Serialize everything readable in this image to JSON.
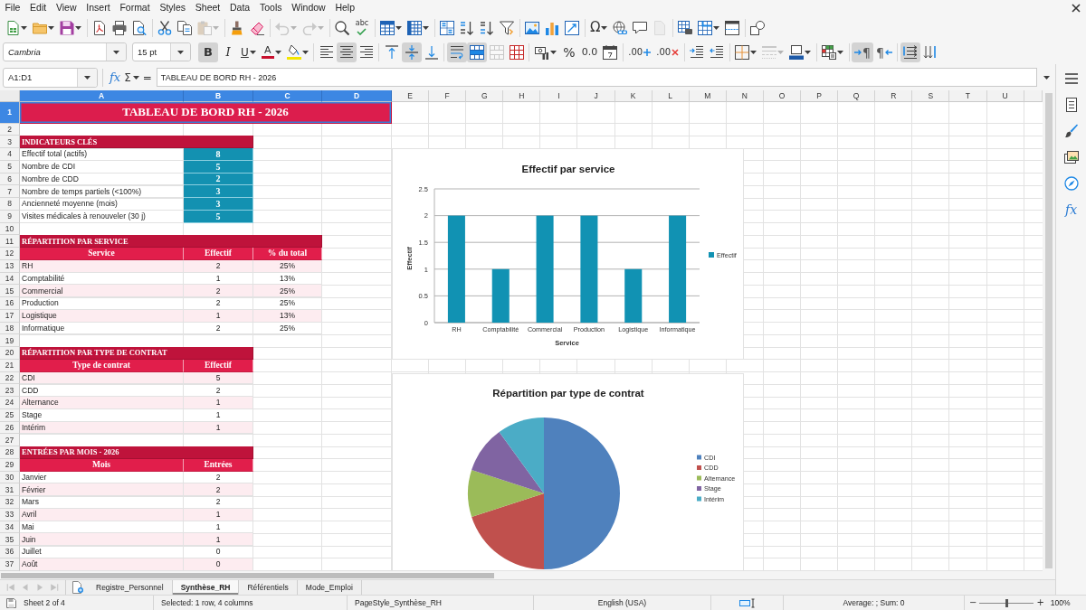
{
  "menu_bar": {
    "items": [
      "File",
      "Edit",
      "View",
      "Insert",
      "Format",
      "Styles",
      "Sheet",
      "Data",
      "Tools",
      "Window",
      "Help"
    ]
  },
  "standard_toolbar": [
    {
      "kind": "new",
      "dropdown": true,
      "disabled": false
    },
    {
      "kind": "open",
      "dropdown": true,
      "disabled": false
    },
    {
      "kind": "save",
      "dropdown": true,
      "disabled": false
    },
    {
      "kind": "separator"
    },
    {
      "kind": "export_pdf",
      "dropdown": false,
      "disabled": false
    },
    {
      "kind": "print",
      "dropdown": false,
      "disabled": false
    },
    {
      "kind": "print_preview",
      "dropdown": false,
      "disabled": false
    },
    {
      "kind": "separator"
    },
    {
      "kind": "cut",
      "dropdown": false,
      "disabled": false
    },
    {
      "kind": "copy",
      "dropdown": false,
      "disabled": false
    },
    {
      "kind": "paste",
      "dropdown": true,
      "disabled": true
    },
    {
      "kind": "separator"
    },
    {
      "kind": "clone_formatting",
      "dropdown": false,
      "disabled": false
    },
    {
      "kind": "clear_formatting",
      "dropdown": false,
      "disabled": false
    },
    {
      "kind": "separator"
    },
    {
      "kind": "undo",
      "dropdown": true,
      "disabled": true
    },
    {
      "kind": "redo",
      "dropdown": true,
      "disabled": true
    },
    {
      "kind": "separator"
    },
    {
      "kind": "find_replace",
      "dropdown": false,
      "disabled": false
    },
    {
      "kind": "spelling",
      "glyph": "abc",
      "dropdown": false,
      "disabled": false
    },
    {
      "kind": "separator"
    },
    {
      "kind": "row",
      "dropdown": true,
      "disabled": false
    },
    {
      "kind": "column",
      "dropdown": true,
      "disabled": false
    },
    {
      "kind": "separator"
    },
    {
      "kind": "sort",
      "dropdown": false,
      "disabled": false
    },
    {
      "kind": "sort_ascending",
      "dropdown": false,
      "disabled": false
    },
    {
      "kind": "sort_descending",
      "dropdown": false,
      "disabled": false
    },
    {
      "kind": "autofilter",
      "dropdown": false,
      "disabled": false
    },
    {
      "kind": "separator"
    },
    {
      "kind": "image",
      "dropdown": false,
      "disabled": false
    },
    {
      "kind": "chart",
      "dropdown": false,
      "disabled": false
    },
    {
      "kind": "pivot_table",
      "dropdown": false,
      "disabled": false
    },
    {
      "kind": "separator"
    },
    {
      "kind": "special_character",
      "glyph": "Ω",
      "dropdown": true,
      "disabled": false
    },
    {
      "kind": "hyperlink",
      "dropdown": false,
      "disabled": false
    },
    {
      "kind": "comment",
      "dropdown": false,
      "disabled": false
    },
    {
      "kind": "header_footer",
      "dropdown": false,
      "disabled": true
    },
    {
      "kind": "separator"
    },
    {
      "kind": "print_range",
      "dropdown": false,
      "disabled": false
    },
    {
      "kind": "freeze",
      "dropdown": true,
      "disabled": false
    },
    {
      "kind": "split_window",
      "dropdown": false,
      "disabled": false
    },
    {
      "kind": "separator"
    },
    {
      "kind": "shapes",
      "dropdown": false,
      "disabled": false
    }
  ],
  "format_toolbar": {
    "font_name": "Cambria",
    "font_size": "15 pt",
    "tools": [
      {
        "kind": "bold",
        "glyph": "B",
        "on": true,
        "dropdown": false,
        "disabled": false
      },
      {
        "kind": "italic",
        "glyph": "I",
        "on": false,
        "dropdown": false,
        "disabled": false
      },
      {
        "kind": "underline",
        "glyph": "U",
        "on": false,
        "dropdown": true,
        "disabled": false
      },
      {
        "kind": "font_color",
        "glyph": "A",
        "on": false,
        "dropdown": true,
        "disabled": false
      },
      {
        "kind": "highlight",
        "on": false,
        "dropdown": true,
        "disabled": false
      },
      {
        "kind": "separator"
      },
      {
        "kind": "align_left",
        "on": false,
        "dropdown": false,
        "disabled": false
      },
      {
        "kind": "align_center",
        "on": true,
        "dropdown": false,
        "disabled": false
      },
      {
        "kind": "align_right",
        "on": false,
        "dropdown": false,
        "disabled": false
      },
      {
        "kind": "separator"
      },
      {
        "kind": "align_top",
        "on": false,
        "dropdown": false,
        "disabled": false
      },
      {
        "kind": "align_middle",
        "on": true,
        "dropdown": false,
        "disabled": false
      },
      {
        "kind": "align_bottom",
        "on": false,
        "dropdown": false,
        "disabled": false
      },
      {
        "kind": "separator"
      },
      {
        "kind": "wrap_text",
        "on": true,
        "dropdown": false,
        "disabled": false
      },
      {
        "kind": "merge_center",
        "on": true,
        "dropdown": false,
        "disabled": false
      },
      {
        "kind": "merge_cells",
        "on": false,
        "dropdown": false,
        "disabled": true
      },
      {
        "kind": "unmerge_cells",
        "on": false,
        "dropdown": false,
        "disabled": false
      },
      {
        "kind": "separator"
      },
      {
        "kind": "currency",
        "on": false,
        "dropdown": true,
        "disabled": false
      },
      {
        "kind": "percent",
        "glyph": "%",
        "on": false,
        "dropdown": false,
        "disabled": false
      },
      {
        "kind": "number",
        "glyph": "0.0",
        "on": false,
        "dropdown": false,
        "disabled": false
      },
      {
        "kind": "date",
        "on": false,
        "dropdown": false,
        "disabled": false
      },
      {
        "kind": "separator"
      },
      {
        "kind": "add_decimal",
        "glyph": ".00",
        "on": false,
        "dropdown": false,
        "disabled": false
      },
      {
        "kind": "delete_decimal",
        "glyph": ".00",
        "on": false,
        "dropdown": false,
        "disabled": false
      },
      {
        "kind": "separator"
      },
      {
        "kind": "increase_indent",
        "on": false,
        "dropdown": false,
        "disabled": false
      },
      {
        "kind": "decrease_indent",
        "on": false,
        "dropdown": false,
        "disabled": false
      },
      {
        "kind": "separator"
      },
      {
        "kind": "borders",
        "on": false,
        "dropdown": true,
        "disabled": false
      },
      {
        "kind": "border_style",
        "on": false,
        "dropdown": true,
        "disabled": true
      },
      {
        "kind": "border_color",
        "on": false,
        "dropdown": true,
        "disabled": false
      },
      {
        "kind": "separator"
      },
      {
        "kind": "conditional",
        "on": false,
        "dropdown": true,
        "disabled": false
      },
      {
        "kind": "separator"
      },
      {
        "kind": "left_to_right",
        "glyph": "¶",
        "on": true,
        "dropdown": false,
        "disabled": false
      },
      {
        "kind": "right_to_left",
        "glyph": "¶",
        "on": false,
        "dropdown": false,
        "disabled": false
      },
      {
        "kind": "separator"
      },
      {
        "kind": "text_flow",
        "on": true,
        "dropdown": false,
        "disabled": false
      },
      {
        "kind": "vertical_text",
        "on": false,
        "dropdown": false,
        "disabled": false
      }
    ]
  },
  "formula_bar": {
    "name_box": "A1:D1",
    "function_wizard": "fx",
    "sum": "Σ",
    "formula": "=",
    "content": "TABLEAU DE BORD RH - 2026"
  },
  "sidebar": {
    "items": [
      {
        "kind": "menu"
      },
      {
        "kind": "properties"
      },
      {
        "kind": "styles"
      },
      {
        "kind": "gallery"
      },
      {
        "kind": "navigator"
      },
      {
        "kind": "functions",
        "glyph": "fx"
      }
    ]
  },
  "sheet": {
    "column_headers": [
      {
        "label": "A",
        "selected": true
      },
      {
        "label": "B",
        "selected": true
      },
      {
        "label": "C",
        "selected": true
      },
      {
        "label": "D",
        "selected": true
      },
      {
        "label": "E",
        "selected": false
      },
      {
        "label": "F",
        "selected": false
      },
      {
        "label": "G",
        "selected": false
      },
      {
        "label": "H",
        "selected": false
      },
      {
        "label": "I",
        "selected": false
      },
      {
        "label": "J",
        "selected": false
      },
      {
        "label": "K",
        "selected": false
      },
      {
        "label": "L",
        "selected": false
      },
      {
        "label": "M",
        "selected": false
      },
      {
        "label": "N",
        "selected": false
      },
      {
        "label": "O",
        "selected": false
      },
      {
        "label": "P",
        "selected": false
      },
      {
        "label": "Q",
        "selected": false
      },
      {
        "label": "R",
        "selected": false
      },
      {
        "label": "S",
        "selected": false
      },
      {
        "label": "T",
        "selected": false
      },
      {
        "label": "U",
        "selected": false
      }
    ],
    "row_headers": [
      {
        "label": "1",
        "selected": true
      },
      {
        "label": "2",
        "selected": false
      },
      {
        "label": "3",
        "selected": false
      },
      {
        "label": "4",
        "selected": false
      },
      {
        "label": "5",
        "selected": false
      },
      {
        "label": "6",
        "selected": false
      },
      {
        "label": "7",
        "selected": false
      },
      {
        "label": "8",
        "selected": false
      },
      {
        "label": "9",
        "selected": false
      },
      {
        "label": "10",
        "selected": false
      },
      {
        "label": "11",
        "selected": false
      },
      {
        "label": "12",
        "selected": false
      },
      {
        "label": "13",
        "selected": false
      },
      {
        "label": "14",
        "selected": false
      },
      {
        "label": "15",
        "selected": false
      },
      {
        "label": "16",
        "selected": false
      },
      {
        "label": "17",
        "selected": false
      },
      {
        "label": "18",
        "selected": false
      },
      {
        "label": "19",
        "selected": false
      },
      {
        "label": "20",
        "selected": false
      },
      {
        "label": "21",
        "selected": false
      },
      {
        "label": "22",
        "selected": false
      },
      {
        "label": "23",
        "selected": false
      },
      {
        "label": "24",
        "selected": false
      },
      {
        "label": "25",
        "selected": false
      },
      {
        "label": "26",
        "selected": false
      },
      {
        "label": "27",
        "selected": false
      },
      {
        "label": "28",
        "selected": false
      },
      {
        "label": "29",
        "selected": false
      },
      {
        "label": "30",
        "selected": false
      },
      {
        "label": "31",
        "selected": false
      },
      {
        "label": "32",
        "selected": false
      },
      {
        "label": "33",
        "selected": false
      },
      {
        "label": "34",
        "selected": false
      },
      {
        "label": "35",
        "selected": false
      },
      {
        "label": "36",
        "selected": false
      },
      {
        "label": "37",
        "selected": false
      }
    ],
    "title": "TABLEAU DE BORD RH - 2026",
    "blocks": [
      {
        "kind": "kpi",
        "title": "INDICATEURS CLÉS",
        "rows": [
          {
            "label": "Effectif total (actifs)",
            "value": "8"
          },
          {
            "label": "Nombre de CDI",
            "value": "5"
          },
          {
            "label": "Nombre de CDD",
            "value": "2"
          },
          {
            "label": "Nombre de temps partiels (<100%)",
            "value": "3"
          },
          {
            "label": "Ancienneté moyenne (mois)",
            "value": "3"
          },
          {
            "label": "Visites médicales à renouveler (30 j)",
            "value": "5"
          }
        ]
      },
      {
        "kind": "table",
        "title": "RÉPARTITION PAR SERVICE",
        "columns": [
          "Service",
          "Effectif",
          "% du total"
        ],
        "rows": [
          {
            "cells": [
              "RH",
              "2",
              "25%"
            ],
            "shaded": true
          },
          {
            "cells": [
              "Comptabilité",
              "1",
              "13%"
            ],
            "shaded": false
          },
          {
            "cells": [
              "Commercial",
              "2",
              "25%"
            ],
            "shaded": true
          },
          {
            "cells": [
              "Production",
              "2",
              "25%"
            ],
            "shaded": false
          },
          {
            "cells": [
              "Logistique",
              "1",
              "13%"
            ],
            "shaded": true
          },
          {
            "cells": [
              "Informatique",
              "2",
              "25%"
            ],
            "shaded": false
          }
        ]
      },
      {
        "kind": "table",
        "title": "RÉPARTITION PAR TYPE DE CONTRAT",
        "columns": [
          "Type de contrat",
          "Effectif"
        ],
        "rows": [
          {
            "cells": [
              "CDI",
              "5"
            ],
            "shaded": true
          },
          {
            "cells": [
              "CDD",
              "2"
            ],
            "shaded": false
          },
          {
            "cells": [
              "Alternance",
              "1"
            ],
            "shaded": true
          },
          {
            "cells": [
              "Stage",
              "1"
            ],
            "shaded": false
          },
          {
            "cells": [
              "Intérim",
              "1"
            ],
            "shaded": true
          }
        ]
      },
      {
        "kind": "table",
        "title": "ENTRÉES PAR MOIS - 2026",
        "columns": [
          "Mois",
          "Entrées"
        ],
        "rows": [
          {
            "cells": [
              "Janvier",
              "2"
            ],
            "shaded": false
          },
          {
            "cells": [
              "Février",
              "2"
            ],
            "shaded": true
          },
          {
            "cells": [
              "Mars",
              "2"
            ],
            "shaded": false
          },
          {
            "cells": [
              "Avril",
              "1"
            ],
            "shaded": true
          },
          {
            "cells": [
              "Mai",
              "1"
            ],
            "shaded": false
          },
          {
            "cells": [
              "Juin",
              "1"
            ],
            "shaded": true
          },
          {
            "cells": [
              "Juillet",
              "0"
            ],
            "shaded": false
          },
          {
            "cells": [
              "Août",
              "0"
            ],
            "shaded": true
          }
        ]
      }
    ],
    "charts": [
      {
        "chart_data": {
          "type": "bar",
          "title": "Effectif par service",
          "xlabel": "Service",
          "ylabel": "Effectif",
          "categories": [
            "RH",
            "Comptabilité",
            "Commercial",
            "Production",
            "Logistique",
            "Informatique"
          ],
          "series": [
            {
              "name": "Effectif",
              "color": "#1192b3",
              "values": [
                2,
                1,
                2,
                2,
                1,
                2
              ]
            }
          ],
          "ylim": [
            0,
            2.5
          ],
          "yticks": [
            {
              "value": 0,
              "label": "0"
            },
            {
              "value": 0.5,
              "label": "0.5"
            },
            {
              "value": 1,
              "label": "1"
            },
            {
              "value": 1.5,
              "label": "1.5"
            },
            {
              "value": 2,
              "label": "2"
            },
            {
              "value": 2.5,
              "label": "2.5"
            }
          ],
          "grid": true,
          "legend": "right"
        }
      },
      {
        "chart_data": {
          "type": "pie",
          "title": "Répartition par type de contrat",
          "categories": [
            "CDI",
            "CDD",
            "Alternance",
            "Stage",
            "Intérim"
          ],
          "values": [
            50,
            20,
            10,
            10,
            10
          ],
          "colors": [
            "#4f81bd",
            "#c0504d",
            "#9bbb59",
            "#8064a2",
            "#4bacc6"
          ],
          "legend": "right"
        }
      }
    ]
  },
  "sheet_tabs": {
    "navigation": [
      {
        "kind": "first",
        "disabled": true
      },
      {
        "kind": "previous",
        "disabled": true
      },
      {
        "kind": "next",
        "disabled": true
      },
      {
        "kind": "last",
        "disabled": true
      }
    ],
    "tabs": [
      {
        "label": "Registre_Personnel",
        "selected": false
      },
      {
        "label": "Synthèse_RH",
        "selected": true
      },
      {
        "label": "Référentiels",
        "selected": false
      },
      {
        "label": "Mode_Emploi",
        "selected": false
      }
    ]
  },
  "status_bar": {
    "sheet": "Sheet 2 of 4",
    "selection": "Selected: 1 row, 4 columns",
    "page_style": "PageStyle_Synthèse_RH",
    "language": "English (USA)",
    "statistics": "Average: ; Sum: 0",
    "zoom": {
      "out": "−",
      "in": "+",
      "level": 0.5,
      "reading": "100%"
    }
  }
}
